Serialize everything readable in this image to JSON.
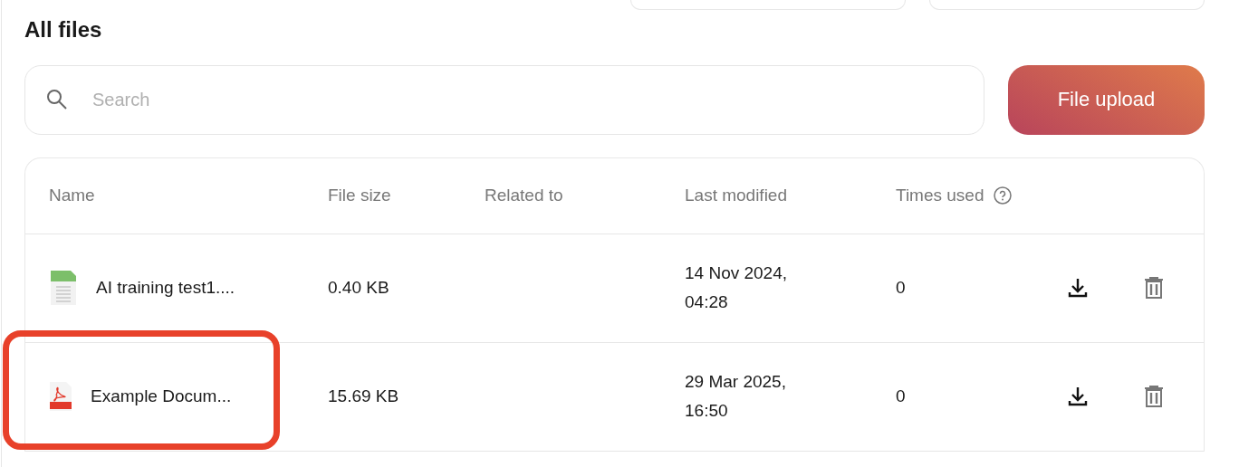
{
  "title": "All files",
  "search": {
    "placeholder": "Search"
  },
  "upload_button": "File upload",
  "table": {
    "columns": [
      "Name",
      "File size",
      "Related to",
      "Last modified",
      "Times used"
    ],
    "rows": [
      {
        "kind": "csv",
        "name": "AI training test1....",
        "size": "0.40 KB",
        "modified": "14 Nov 2024, 04:28",
        "times_used": "0",
        "highlighted": false
      },
      {
        "kind": "pdf",
        "name": "Example Docum...",
        "size": "15.69 KB",
        "modified": "29 Mar 2025, 16:50",
        "times_used": "0",
        "highlighted": true
      }
    ]
  }
}
